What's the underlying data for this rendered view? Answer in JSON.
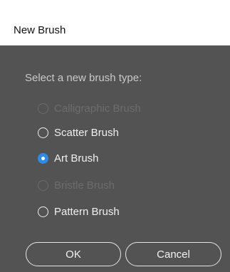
{
  "dialog": {
    "title": "New Brush",
    "prompt": "Select a new brush type:",
    "options": [
      {
        "label": "Calligraphic Brush",
        "enabled": false,
        "selected": false
      },
      {
        "label": "Scatter Brush",
        "enabled": true,
        "selected": false
      },
      {
        "label": "Art Brush",
        "enabled": true,
        "selected": true
      },
      {
        "label": "Bristle Brush",
        "enabled": false,
        "selected": false
      },
      {
        "label": "Pattern Brush",
        "enabled": true,
        "selected": false
      }
    ],
    "ok_label": "OK",
    "cancel_label": "Cancel"
  },
  "colors": {
    "background": "#535353",
    "titlebar": "#ffffff",
    "accent": "#2d8ceb",
    "disabled_text": "#6c6c6c"
  }
}
